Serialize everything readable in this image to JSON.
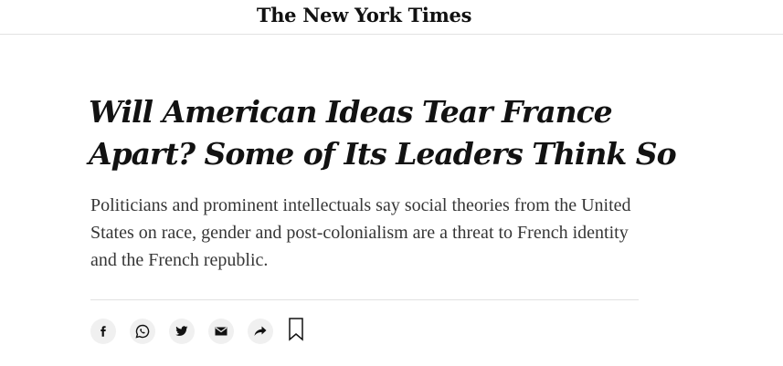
{
  "masthead": {
    "logo_text": "The New York Times"
  },
  "article": {
    "headline": "Will American Ideas Tear France Apart? Some of Its Leaders Think So",
    "summary": "Politicians and prominent intellectuals say social theories from the United States on race, gender and post-colonialism are a threat to French identity and the French republic."
  },
  "share_bar": {
    "buttons": [
      {
        "icon": "facebook-icon"
      },
      {
        "icon": "whatsapp-icon"
      },
      {
        "icon": "twitter-icon"
      },
      {
        "icon": "email-icon"
      },
      {
        "icon": "share-arrow-icon"
      }
    ],
    "bookmark_icon": "bookmark-icon"
  },
  "colors": {
    "text": "#121212",
    "summary_text": "#363636",
    "divider": "#e2e2e2",
    "button_bg": "#f0f0f0"
  }
}
